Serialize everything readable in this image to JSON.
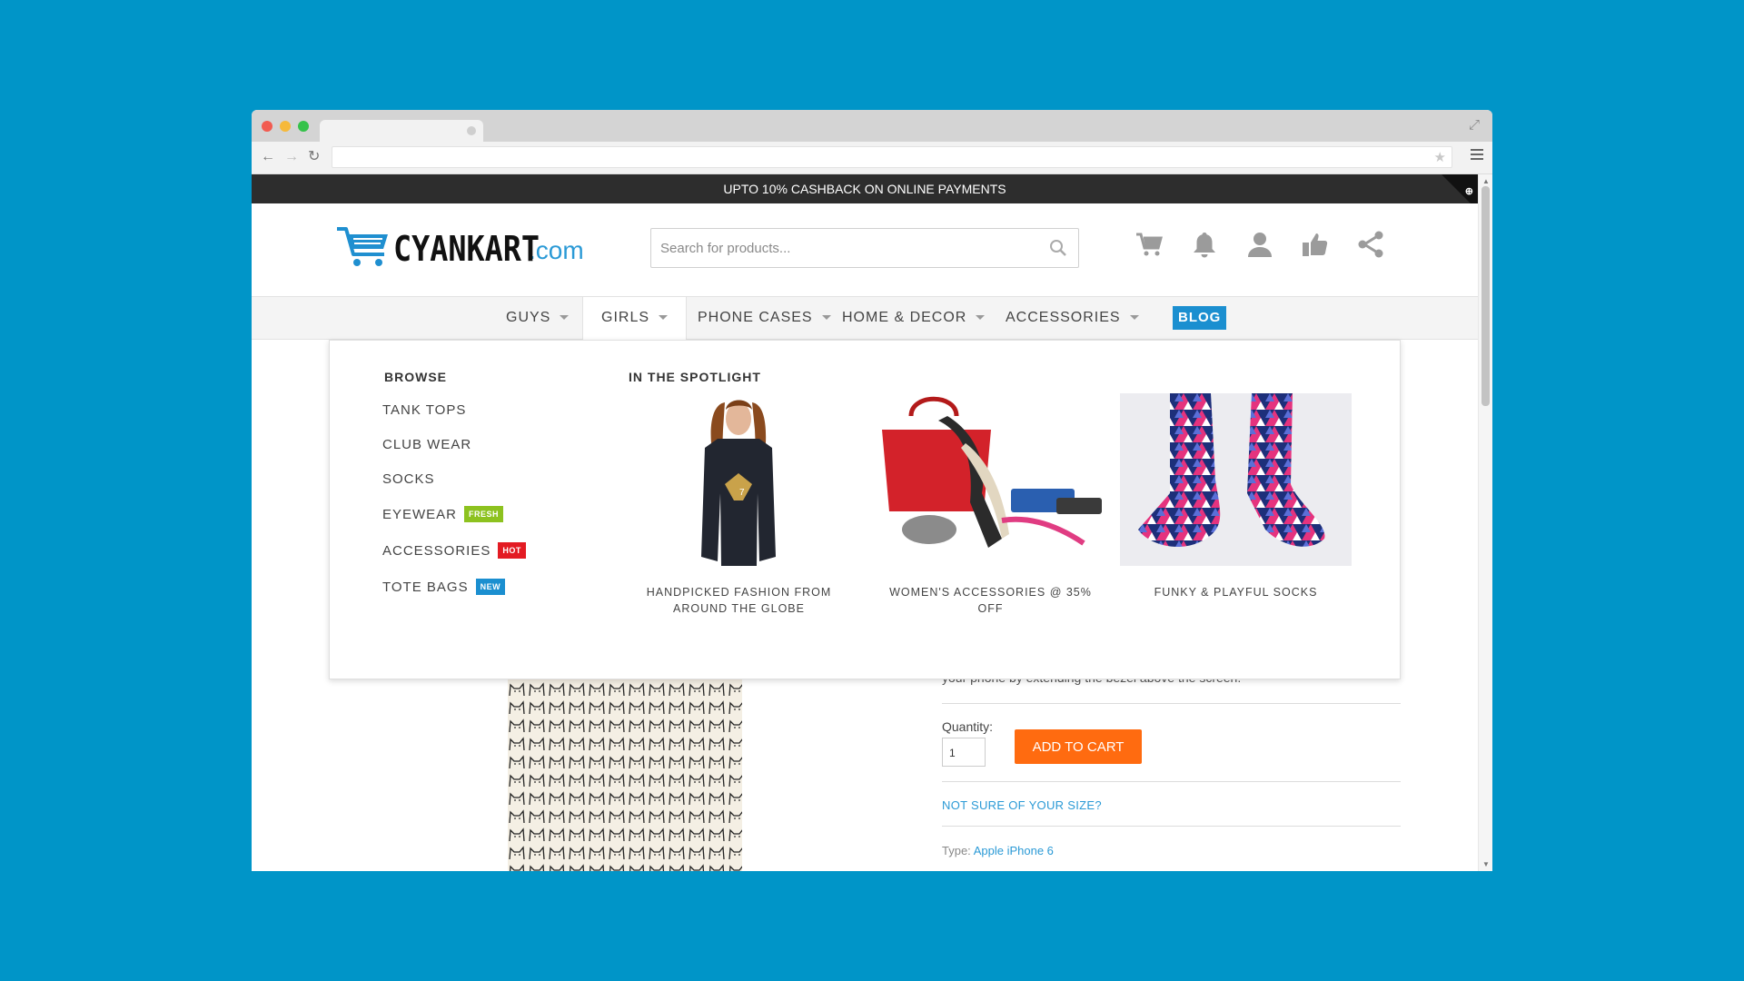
{
  "promo": {
    "text": "UPTO 10% CASHBACK ON ONLINE PAYMENTS"
  },
  "brand": {
    "name": "CYANKART",
    "suffix": ".com",
    "accent": "#2b9ad6"
  },
  "search": {
    "placeholder": "Search for products..."
  },
  "header_icons": [
    "cart-icon",
    "bell-icon",
    "user-icon",
    "thumbs-up-icon",
    "share-icon"
  ],
  "nav": {
    "items": [
      "GUYS",
      "GIRLS",
      "PHONE CASES",
      "HOME & DECOR",
      "ACCESSORIES"
    ],
    "active": "GIRLS",
    "blog": "BLOG"
  },
  "mega": {
    "browse_title": "BROWSE",
    "browse": [
      {
        "label": "TANK TOPS",
        "badge": ""
      },
      {
        "label": "CLUB WEAR",
        "badge": ""
      },
      {
        "label": "SOCKS",
        "badge": ""
      },
      {
        "label": "EYEWEAR",
        "badge": "FRESH"
      },
      {
        "label": "ACCESSORIES",
        "badge": "HOT"
      },
      {
        "label": "TOTE BAGS",
        "badge": "NEW"
      }
    ],
    "spotlight_title": "IN THE SPOTLIGHT",
    "spotlight": [
      {
        "caption": "HANDPICKED FASHION FROM AROUND THE GLOBE"
      },
      {
        "caption": "WOMEN'S ACCESSORIES @ 35% OFF"
      },
      {
        "caption": "FUNKY & PLAYFUL SOCKS"
      }
    ]
  },
  "product": {
    "description_tail": "your phone by extending the bezel above the screen.",
    "quantity_label": "Quantity:",
    "quantity_value": "1",
    "add_to_cart": "ADD TO CART",
    "size_link": "NOT SURE OF YOUR SIZE?",
    "type_label": "Type:",
    "type_value": "Apple iPhone 6"
  },
  "colors": {
    "page_bg": "#0095c8",
    "button": "#ff6b10",
    "fresh": "#8dc21f",
    "hot": "#e31b23",
    "new": "#1b8fd0"
  }
}
